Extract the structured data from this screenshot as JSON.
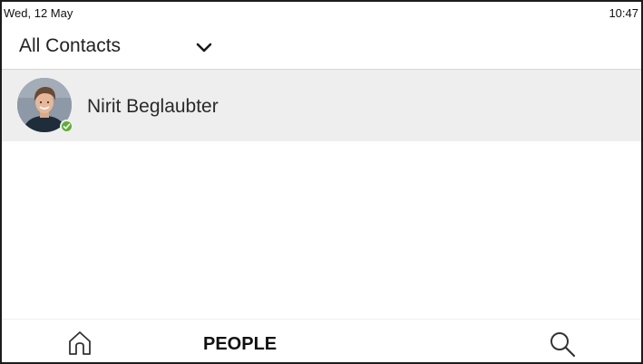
{
  "status_bar": {
    "date": "Wed, 12 May",
    "time": "10:47"
  },
  "filter": {
    "selected": "All Contacts",
    "icon": "chevron-down-icon"
  },
  "contacts": [
    {
      "name": "Nirit Beglaubter",
      "presence": "available",
      "presence_color": "#5db031",
      "avatar": "user-photo"
    }
  ],
  "bottom_nav": {
    "home_icon": "home-icon",
    "people_label": "PEOPLE",
    "search_icon": "search-icon"
  },
  "colors": {
    "selected_row": "#eeeeee",
    "divider": "#d6d6d6",
    "text": "#222222"
  }
}
